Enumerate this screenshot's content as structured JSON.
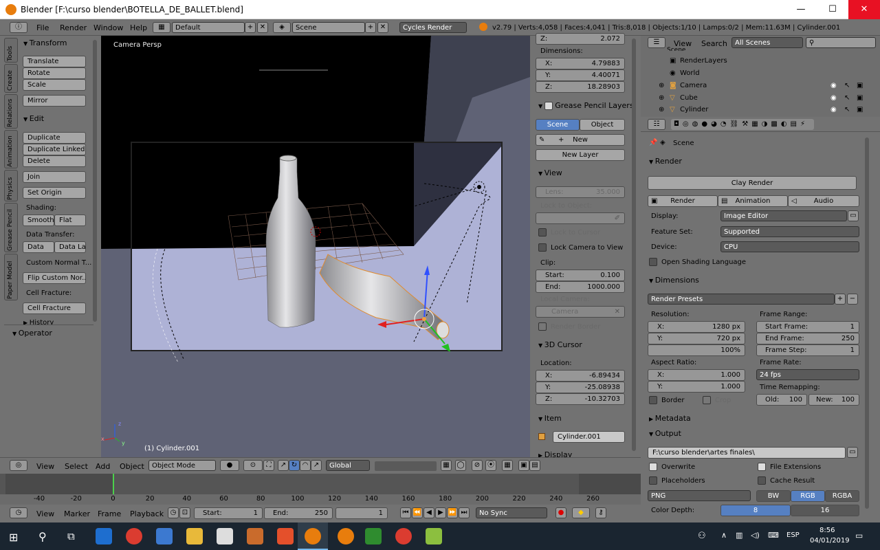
{
  "window": {
    "title": "Blender [F:\\curso blender\\BOTELLA_DE_BALLET.blend]",
    "minimize": "—",
    "maximize": "☐",
    "close": "✕"
  },
  "infobar": {
    "menus": [
      "File",
      "Render",
      "Window",
      "Help"
    ],
    "layout": "Default",
    "scene": "Scene",
    "engine": "Cycles Render",
    "stats": "v2.79 | Verts:4,058 | Faces:4,041 | Tris:8,018 | Objects:1/10 | Lamps:0/2 | Mem:11.63M | Cylinder.001"
  },
  "tool_tabs": [
    "Tools",
    "Create",
    "Relations",
    "Animation",
    "Physics",
    "Grease Pencil",
    "Paper Model"
  ],
  "tools": {
    "transform_header": "Transform",
    "translate": "Translate",
    "rotate": "Rotate",
    "scale": "Scale",
    "mirror": "Mirror",
    "edit_header": "Edit",
    "duplicate": "Duplicate",
    "duplicate_linked": "Duplicate Linked",
    "delete": "Delete",
    "join": "Join",
    "set_origin": "Set Origin",
    "shading_label": "Shading:",
    "smooth": "Smooth",
    "flat": "Flat",
    "data_transfer_label": "Data Transfer:",
    "data": "Data",
    "data_la": "Data La",
    "custom_normal": "Custom Normal T...",
    "flip_custom": "Flip Custom Nor...",
    "cell_fracture_label": "Cell Fracture:",
    "cell_fracture": "Cell Fracture",
    "history": "History",
    "operator_header": "Operator"
  },
  "viewport": {
    "view_label": "Camera Persp",
    "object_label": "(1) Cylinder.001",
    "axis_z": "z",
    "axis_x": "x",
    "axis_y": "y"
  },
  "viewport_header": {
    "view": "View",
    "select": "Select",
    "add": "Add",
    "object": "Object",
    "mode": "Object Mode",
    "orientation": "Global"
  },
  "npanel": {
    "z_top": "2.072",
    "dimensions_label": "Dimensions:",
    "dim_x_label": "X:",
    "dim_x": "4.79883",
    "dim_y_label": "Y:",
    "dim_y": "4.40071",
    "dim_z_label": "Z:",
    "dim_z": "18.28903",
    "grease_header": "Grease Pencil Layers",
    "scene_tab": "Scene",
    "object_tab": "Object",
    "new": "New",
    "new_layer": "New Layer",
    "view_header": "View",
    "lens": "Lens:",
    "lens_val": "35.000",
    "lock_to_object": "Lock to Object:",
    "lock_cursor": "Lock to Cursor",
    "lock_camera": "Lock Camera to View",
    "clip_label": "Clip:",
    "clip_start_label": "Start:",
    "clip_start": "0.100",
    "clip_end_label": "End:",
    "clip_end": "1000.000",
    "local_camera": "Local Camera:",
    "camera": "Camera",
    "render_border": "Render Border",
    "cursor_header": "3D Cursor",
    "location_label": "Location:",
    "loc_x_label": "X:",
    "loc_x": "-6.89434",
    "loc_y_label": "Y:",
    "loc_y": "-25.08938",
    "loc_z_label": "Z:",
    "loc_z": "-10.32703",
    "item_header": "Item",
    "item_name": "Cylinder.001",
    "display_header": "Display"
  },
  "outliner": {
    "view": "View",
    "search": "Search",
    "filter": "All Scenes",
    "items": [
      {
        "label": "Scene"
      },
      {
        "label": "RenderLayers"
      },
      {
        "label": "World"
      },
      {
        "label": "Camera"
      },
      {
        "label": "Cube"
      },
      {
        "label": "Cylinder"
      }
    ]
  },
  "properties": {
    "context": "Scene",
    "render_header": "Render",
    "clay_render": "Clay Render",
    "render_btn": "Render",
    "animation_btn": "Animation",
    "audio_btn": "Audio",
    "display_label": "Display:",
    "display_val": "Image Editor",
    "feature_label": "Feature Set:",
    "feature_val": "Supported",
    "device_label": "Device:",
    "device_val": "CPU",
    "osl": "Open Shading Language",
    "dimensions_header": "Dimensions",
    "render_presets": "Render Presets",
    "resolution_label": "Resolution:",
    "res_x_label": "X:",
    "res_x": "1280 px",
    "res_y_label": "Y:",
    "res_y": "720 px",
    "res_pct": "100%",
    "frame_range_label": "Frame Range:",
    "start_frame_label": "Start Frame:",
    "start_frame": "1",
    "end_frame_label": "End Frame:",
    "end_frame": "250",
    "frame_step_label": "Frame Step:",
    "frame_step": "1",
    "aspect_label": "Aspect Ratio:",
    "asp_x_label": "X:",
    "asp_x": "1.000",
    "asp_y_label": "Y:",
    "asp_y": "1.000",
    "frame_rate_label": "Frame Rate:",
    "frame_rate": "24 fps",
    "border": "Border",
    "crop": "Crop",
    "time_remap_label": "Time Remapping:",
    "old_label": "Old:",
    "old": "100",
    "new_label": "New:",
    "new": "100",
    "metadata_header": "Metadata",
    "output_header": "Output",
    "output_path": "F:\\curso blender\\artes finales\\",
    "overwrite": "Overwrite",
    "file_ext": "File Extensions",
    "placeholders": "Placeholders",
    "cache_result": "Cache Result",
    "format": "PNG",
    "bw": "BW",
    "rgb": "RGB",
    "rgba": "RGBA",
    "color_depth_label": "Color Depth:",
    "depth8": "8",
    "depth16": "16"
  },
  "timeline": {
    "ticks": [
      "-40",
      "-20",
      "0",
      "20",
      "40",
      "60",
      "80",
      "100",
      "120",
      "140",
      "160",
      "180",
      "200",
      "220",
      "240",
      "260"
    ],
    "view": "View",
    "marker": "Marker",
    "frame": "Frame",
    "playback": "Playback",
    "start_label": "Start:",
    "start": "1",
    "end_label": "End:",
    "end": "250",
    "current": "1",
    "sync": "No Sync"
  },
  "taskbar": {
    "lang": "ESP",
    "time": "8:56",
    "date": "04/01/2019"
  },
  "colors": {
    "accent": "#5680c2",
    "panel": "#727272",
    "viewport": "#5f6275",
    "title_close": "#e81123",
    "taskbar": "#1a2530"
  }
}
